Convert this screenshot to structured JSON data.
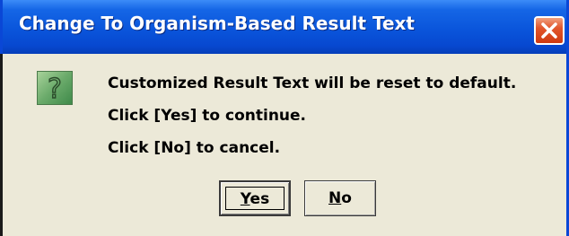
{
  "window": {
    "title": "Change To Organism-Based Result Text",
    "close_icon": "close-x-icon",
    "titlebar_color": "#0a55db",
    "close_button_color": "#e2562c"
  },
  "dialog": {
    "icon": "question-icon",
    "icon_color": "#6aaa6a",
    "message_lines": [
      "Customized Result Text will be reset to default.",
      "Click [Yes] to continue.",
      "Click [No] to cancel."
    ]
  },
  "buttons": {
    "yes": {
      "mnemonic": "Y",
      "rest": "es"
    },
    "no": {
      "mnemonic": "N",
      "rest": "o"
    }
  }
}
